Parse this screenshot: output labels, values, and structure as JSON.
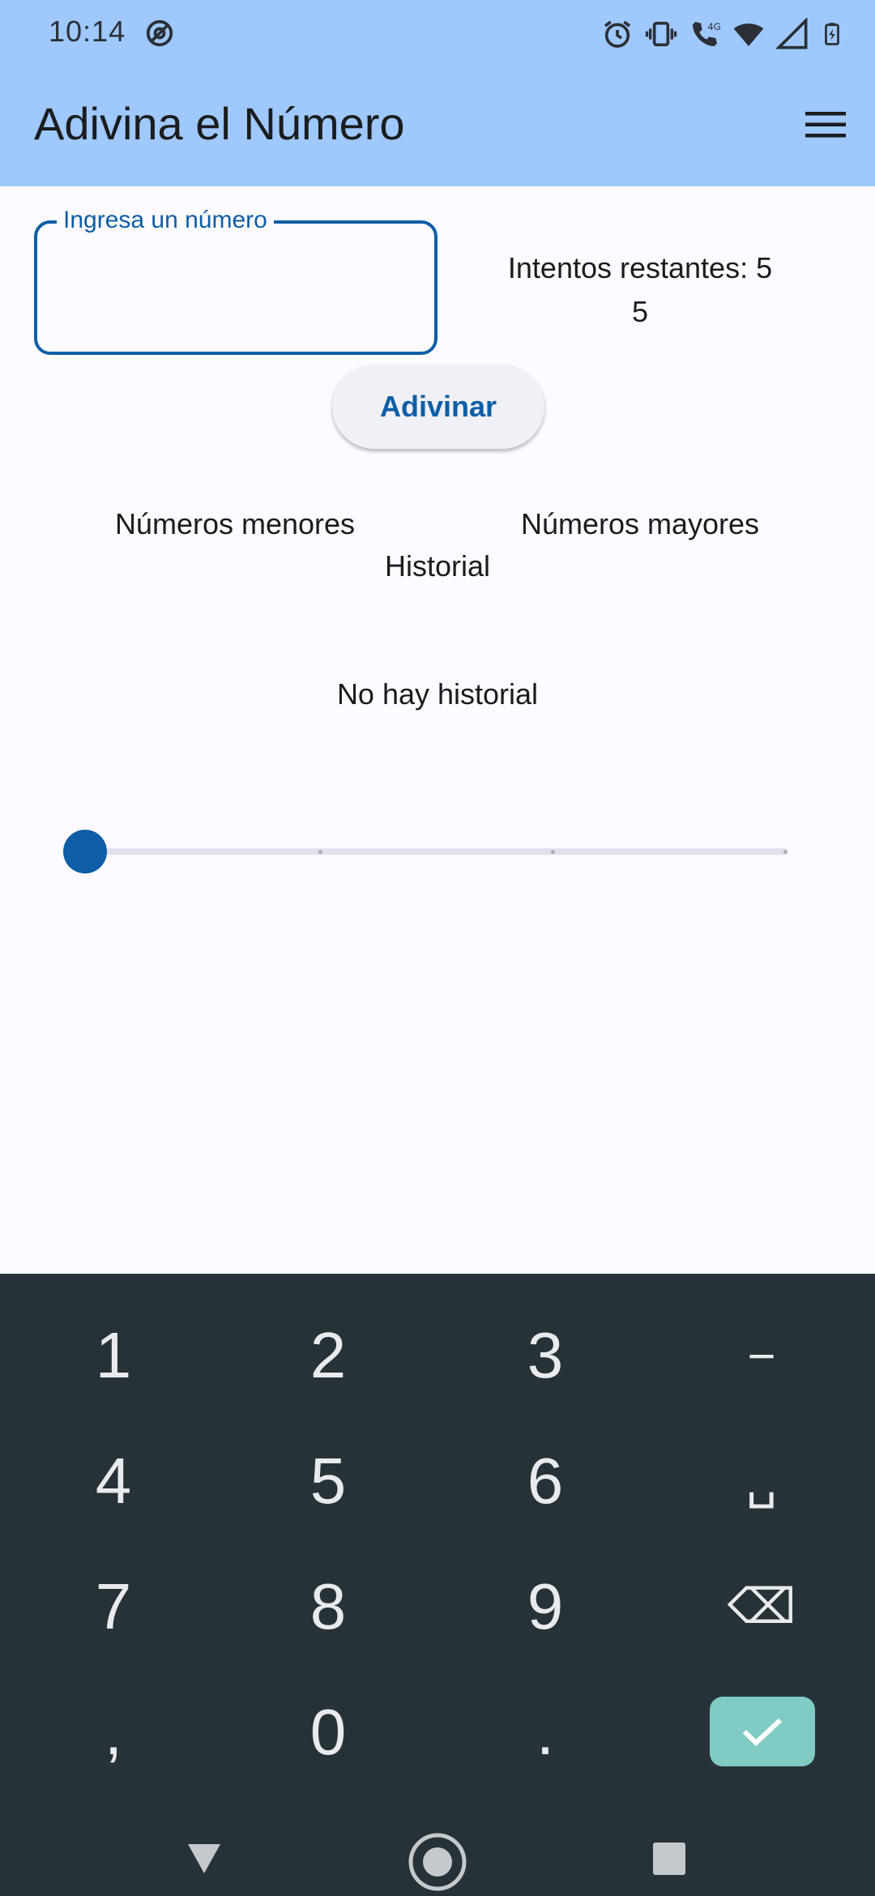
{
  "status_bar": {
    "time": "10:14"
  },
  "app_bar": {
    "title": "Adivina el Número"
  },
  "guess_input": {
    "label": "Ingresa un número",
    "value": ""
  },
  "attempts": {
    "text": "Intentos restantes: 5",
    "value": "5"
  },
  "guess_button": {
    "label": "Adivinar"
  },
  "lists": {
    "lower_label": "Números menores",
    "upper_label": "Números mayores",
    "history_label": "Historial",
    "empty_history": "No hay historial"
  },
  "slider": {
    "value": 0,
    "stops": 4
  },
  "keyboard": {
    "keys": [
      "1",
      "2",
      "3",
      "−",
      "4",
      "5",
      "6",
      "␣",
      "7",
      "8",
      "9",
      "⌫",
      ",",
      "0",
      ".",
      "✓"
    ]
  },
  "colors": {
    "primary": "#0d5ea6",
    "app_bar": "#9fc8fc",
    "keyboard_bg": "#263238",
    "enter_key": "#80cbc4"
  }
}
